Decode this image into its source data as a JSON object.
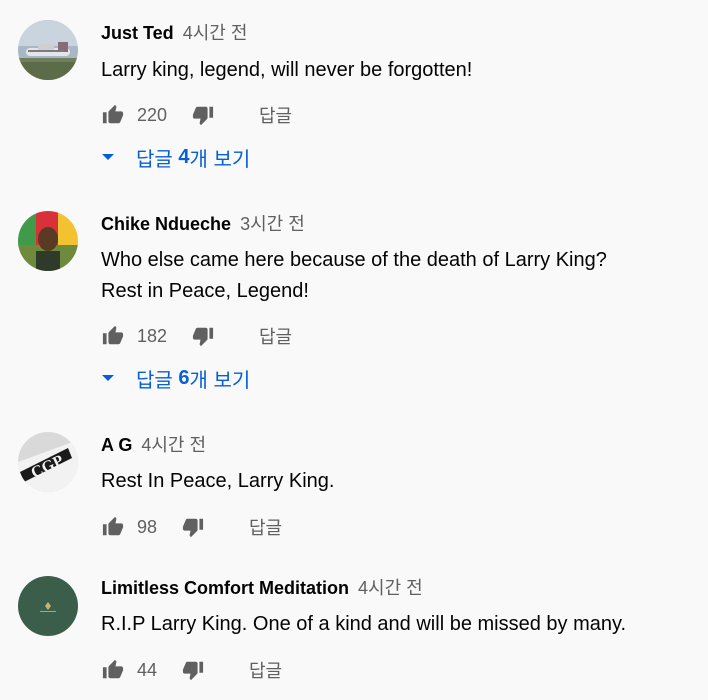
{
  "comments": [
    {
      "author": "Just Ted",
      "time": "4시간 전",
      "text": "Larry king, legend, will never be forgotten!",
      "likes": "220",
      "reply_label": "답글",
      "replies": {
        "prefix": "답글 ",
        "count": "4",
        "suffix": "개 보기"
      }
    },
    {
      "author": "Chike Ndueche",
      "time": "3시간 전",
      "text_line1": "Who else came here because of the death of Larry King?",
      "text_line2": "Rest in Peace, Legend!",
      "likes": "182",
      "reply_label": "답글",
      "replies": {
        "prefix": "답글 ",
        "count": "6",
        "suffix": "개 보기"
      }
    },
    {
      "author": "A G",
      "time": "4시간 전",
      "text": "Rest In Peace, Larry King.",
      "likes": "98",
      "reply_label": "답글"
    },
    {
      "author": "Limitless Comfort Meditation",
      "time": "4시간 전",
      "text": "R.I.P Larry King. One of a kind and will be missed by many.",
      "likes": "44",
      "reply_label": "답글"
    }
  ],
  "colors": {
    "link": "#065fd4",
    "secondary_text": "#606060",
    "primary_text": "#030303",
    "background": "#f9f9f9"
  },
  "icons": {
    "like": "thumb-up-icon",
    "dislike": "thumb-down-icon",
    "expand": "caret-down-icon"
  }
}
